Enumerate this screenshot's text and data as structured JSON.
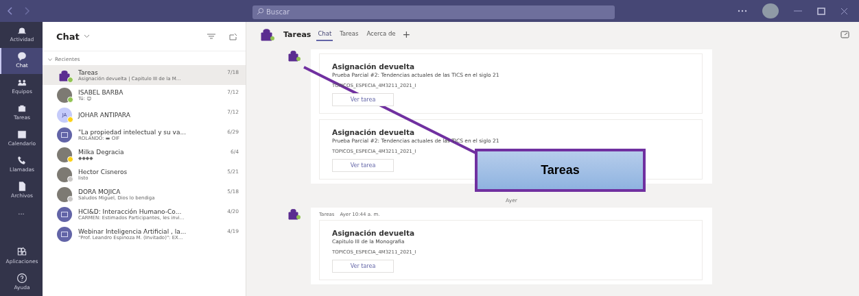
{
  "search": {
    "placeholder": "Buscar"
  },
  "rail": [
    {
      "label": "Actividad",
      "selected": false
    },
    {
      "label": "Chat",
      "selected": true
    },
    {
      "label": "Equipos",
      "selected": false
    },
    {
      "label": "Tareas",
      "selected": false
    },
    {
      "label": "Calendario",
      "selected": false
    },
    {
      "label": "Llamadas",
      "selected": false
    },
    {
      "label": "Archivos",
      "selected": false
    }
  ],
  "rail_more": "...",
  "rail_bottom": [
    {
      "label": "Aplicaciones",
      "selected": false
    },
    {
      "label": "Ayuda",
      "selected": false
    }
  ],
  "chat_list": {
    "title": "Chat",
    "section": "Recientes",
    "items": [
      {
        "kind": "app",
        "name": "Tareas",
        "preview": "Asignación devuelta | Capitulo III de la M...",
        "date": "7/18",
        "selected": true,
        "color": "#92c353"
      },
      {
        "kind": "photo",
        "name": "ISABEL BARBA",
        "preview": "Tú: 😊",
        "date": "7/12",
        "selected": false,
        "color": "#92c353"
      },
      {
        "kind": "initials",
        "initials": "JA",
        "name": "JOHAR ANTIPARA",
        "date": "7/12",
        "selected": false,
        "color": "#fcd116"
      },
      {
        "kind": "meeting",
        "name": "\"La propiedad intelectual y su va...",
        "preview": "ROLANDO: ▬ OIF",
        "date": "6/29",
        "selected": false
      },
      {
        "kind": "photo",
        "name": "Milka Degracia",
        "preview": "◆◆◆◆",
        "date": "6/4",
        "selected": false,
        "color": "#fcd116"
      },
      {
        "kind": "photo",
        "name": "Hector Cisneros",
        "preview": "listo",
        "date": "5/21",
        "selected": false,
        "color": "#c8c6c4"
      },
      {
        "kind": "photo",
        "name": "DORA MOJICA",
        "preview": "Saludos Miguel, Dios lo bendiga",
        "date": "5/18",
        "selected": false,
        "color": "#c8c6c4"
      },
      {
        "kind": "meeting",
        "name": "HCI&D: Interacción Humano-Co...",
        "preview": "CARMEN: Estimados Participantes, les invi...",
        "date": "4/20",
        "selected": false
      },
      {
        "kind": "meeting",
        "name": "Webinar Inteligencia Artificial , la...",
        "preview": "\"Prof. Leandro Espinoza M. (Invitado)\": EX...",
        "date": "4/19",
        "selected": false
      }
    ]
  },
  "conversation": {
    "title": "Tareas",
    "tabs": [
      {
        "label": "Chat",
        "selected": true
      },
      {
        "label": "Tareas",
        "selected": false
      },
      {
        "label": "Acerca de",
        "selected": false
      }
    ],
    "add_tab": "+",
    "groups": [
      {
        "cards": [
          {
            "title": "Asignación devuelta",
            "subtitle": "Prueba Parcial #2: Tendencias actuales de las TICS en el siglo 21",
            "course": "TOPICOS_ESPECIA_4M3211_2021_I",
            "button": "Ver tarea"
          },
          {
            "title": "Asignación devuelta",
            "subtitle": "Prueba Parcial #2: Tendencias actuales de las TICS en el siglo 21",
            "course": "TOPICOS_ESPECIA_4M3211_2021_I",
            "button": "Ver tarea"
          }
        ]
      },
      {
        "divider": "Ayer",
        "sender": "Tareas",
        "time": "Ayer 10:44 a. m.",
        "cards": [
          {
            "title": "Asignación devuelta",
            "subtitle": "Capitulo III de la Monografia",
            "course": "TOPICOS_ESPECIA_4M3211_2021_I",
            "button": "Ver tarea"
          }
        ]
      }
    ]
  },
  "callout": {
    "label": "Tareas"
  }
}
